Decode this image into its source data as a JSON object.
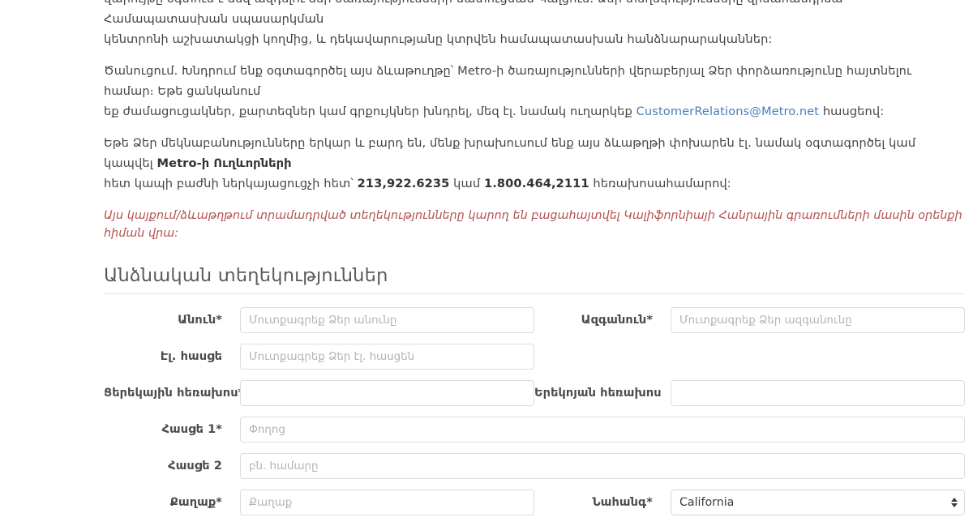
{
  "body": {
    "paragraphs": [
      {
        "id": "p-intro",
        "segments": [
          {
            "type": "text",
            "value": "վարույթը օգտում է ձեզ ազդելու ձեր ծառայությունների մատուցման Կալցում։ Ձեր տեղեկությունները զինահանդիսա Համապատասխան սպասարկման"
          },
          {
            "type": "break"
          },
          {
            "type": "text",
            "value": "կենտրոնի աշխատակցի կողմից, և դեկավարությանը կտրվեն համապատասխան հանձնարարականներ:"
          }
        ]
      },
      {
        "id": "p-note",
        "segments": [
          {
            "type": "text",
            "value": "Ծանուցում. Խնդրում ենք օգտագործել այս ձևաթուղթը՝ Metro-ի ծառայությունների վերաբերյալ Ձեր փորձառությունը հայտնելու համար։ Եթե ցանկանում"
          },
          {
            "type": "break"
          },
          {
            "type": "text",
            "value": "եք ժամացուցակներ, քարտեզներ կամ գրքույկներ խնդրել, մեզ էլ. նամակ ուղարկեք "
          },
          {
            "type": "link",
            "value": "CustomerRelations@Metro.net"
          },
          {
            "type": "text",
            "value": " հասցեով:"
          }
        ]
      },
      {
        "id": "p-complaint",
        "segments": [
          {
            "type": "text",
            "value": "Եթե Ձեր մեկնաբանությունները երկար և բարդ են, մենք խրախուսում ենք այս ձևաթղթի փոխարեն էլ. նամակ օգտագործել կամ կապվել "
          },
          {
            "type": "strong",
            "value": "Metro-ի Ուղևորների"
          },
          {
            "type": "break"
          },
          {
            "type": "text",
            "value": "հետ կապի բաժնի ներկայացուցչի հետ՝ "
          },
          {
            "type": "strong",
            "value": "213,922.6235"
          },
          {
            "type": "text",
            "value": " կամ "
          },
          {
            "type": "strong",
            "value": "1.800.464,2111"
          },
          {
            "type": "text",
            "value": " հեռախոսահամարով:"
          }
        ]
      }
    ],
    "notice": "Այս կայքում/ձևաթղթում տրամադրված տեղեկությունները կարող են բացահայտվել Կալիֆորնիայի Հանրային գրառումների մասին օրենքի հիման վրա:",
    "notice_color": "#b1524f",
    "link_color": "#4a7ebb"
  },
  "section": {
    "title": "Անձնական տեղեկություններ"
  },
  "form": {
    "rows": [
      {
        "id": "row-name",
        "layout": "half-half",
        "left": {
          "name": "first-name",
          "label": "Անուն*",
          "control": "text",
          "placeholder": "Մուտքագրեք Ձեր անունը",
          "value": ""
        },
        "right": {
          "name": "last-name",
          "label": "Ազգանուն*",
          "control": "text",
          "placeholder": "Մուտքագրեք Ձեր ազգանունը",
          "value": ""
        }
      },
      {
        "id": "row-email",
        "layout": "half-empty",
        "left": {
          "name": "email",
          "label": "Էլ. հասցե",
          "control": "text",
          "placeholder": "Մուտքագրեք Ձեր էլ. հասցեն",
          "value": ""
        }
      },
      {
        "id": "row-phones",
        "layout": "half-half",
        "left": {
          "name": "daytime-phone",
          "label": "Ցերեկային հեռախոս*",
          "control": "text",
          "placeholder": "",
          "value": ""
        },
        "right": {
          "name": "evening-phone",
          "label": "Երեկոյան հեռախոս",
          "control": "text",
          "placeholder": "",
          "value": ""
        }
      },
      {
        "id": "row-address1",
        "layout": "full",
        "left": {
          "name": "address-1",
          "label": "Հասցե 1*",
          "control": "text",
          "placeholder": "Փողոց",
          "value": ""
        }
      },
      {
        "id": "row-address2",
        "layout": "full",
        "left": {
          "name": "address-2",
          "label": "Հասցե 2",
          "control": "text",
          "placeholder": "բն. համարը",
          "value": ""
        }
      },
      {
        "id": "row-city-state",
        "layout": "half-half",
        "left": {
          "name": "city",
          "label": "Քաղաք*",
          "control": "text",
          "placeholder": "Քաղաք",
          "value": ""
        },
        "right": {
          "name": "state",
          "label": "Նահանգ*",
          "control": "select",
          "placeholder": "",
          "value": "California"
        }
      }
    ]
  }
}
